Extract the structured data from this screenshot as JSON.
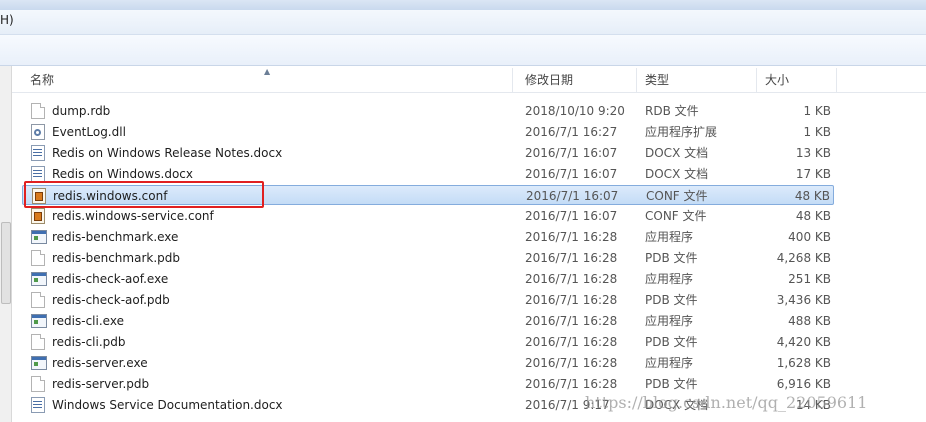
{
  "menubar": {
    "partial_item": "H)"
  },
  "columns": {
    "name": "名称",
    "date": "修改日期",
    "type": "类型",
    "size": "大小"
  },
  "files": [
    {
      "icon": "blank-file-icon",
      "name": "dump.rdb",
      "date": "2018/10/10 9:20",
      "type": "RDB 文件",
      "size": "1 KB"
    },
    {
      "icon": "dll-file-icon",
      "name": "EventLog.dll",
      "date": "2016/7/1 16:27",
      "type": "应用程序扩展",
      "size": "1 KB"
    },
    {
      "icon": "docx-file-icon",
      "name": "Redis on Windows Release Notes.docx",
      "date": "2016/7/1 16:07",
      "type": "DOCX 文档",
      "size": "13 KB"
    },
    {
      "icon": "docx-file-icon",
      "name": "Redis on Windows.docx",
      "date": "2016/7/1 16:07",
      "type": "DOCX 文档",
      "size": "17 KB"
    },
    {
      "icon": "conf-file-icon",
      "name": "redis.windows.conf",
      "date": "2016/7/1 16:07",
      "type": "CONF 文件",
      "size": "48 KB"
    },
    {
      "icon": "conf-file-icon",
      "name": "redis.windows-service.conf",
      "date": "2016/7/1 16:07",
      "type": "CONF 文件",
      "size": "48 KB"
    },
    {
      "icon": "exe-file-icon",
      "name": "redis-benchmark.exe",
      "date": "2016/7/1 16:28",
      "type": "应用程序",
      "size": "400 KB"
    },
    {
      "icon": "blank-file-icon",
      "name": "redis-benchmark.pdb",
      "date": "2016/7/1 16:28",
      "type": "PDB 文件",
      "size": "4,268 KB"
    },
    {
      "icon": "exe-file-icon",
      "name": "redis-check-aof.exe",
      "date": "2016/7/1 16:28",
      "type": "应用程序",
      "size": "251 KB"
    },
    {
      "icon": "blank-file-icon",
      "name": "redis-check-aof.pdb",
      "date": "2016/7/1 16:28",
      "type": "PDB 文件",
      "size": "3,436 KB"
    },
    {
      "icon": "exe-file-icon",
      "name": "redis-cli.exe",
      "date": "2016/7/1 16:28",
      "type": "应用程序",
      "size": "488 KB"
    },
    {
      "icon": "blank-file-icon",
      "name": "redis-cli.pdb",
      "date": "2016/7/1 16:28",
      "type": "PDB 文件",
      "size": "4,420 KB"
    },
    {
      "icon": "exe-file-icon",
      "name": "redis-server.exe",
      "date": "2016/7/1 16:28",
      "type": "应用程序",
      "size": "1,628 KB"
    },
    {
      "icon": "blank-file-icon",
      "name": "redis-server.pdb",
      "date": "2016/7/1 16:28",
      "type": "PDB 文件",
      "size": "6,916 KB"
    },
    {
      "icon": "docx-file-icon",
      "name": "Windows Service Documentation.docx",
      "date": "2016/7/1 9:17",
      "type": "DOCX 文档",
      "size": "14 KB"
    }
  ],
  "selected_index": 4,
  "watermark": "https://blog.csdn.net/qq_22059611",
  "colors": {
    "selection_bg": "#cde1f7",
    "selection_border": "#84acdd",
    "annotation_red": "#e02020"
  }
}
